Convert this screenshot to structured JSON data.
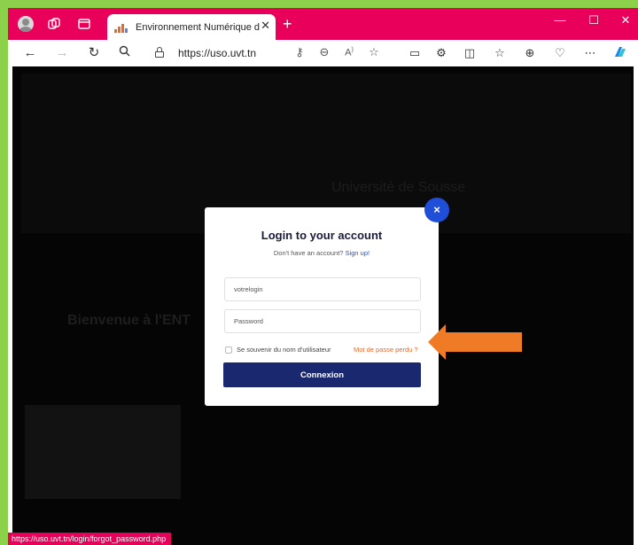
{
  "browser": {
    "tab_title": "Environnement Numérique de Tr",
    "url": "https://uso.uvt.tn",
    "status_url": "https://uso.uvt.tn/login/forgot_password.php",
    "accent_color": "#e8005a",
    "frame_color": "#8bd14a"
  },
  "page": {
    "hero_title": "Université de Sousse",
    "welcome_text": "Bienvenue à l'ENT"
  },
  "modal": {
    "title": "Login to your account",
    "subtitle_prefix": "Don't have an account?",
    "signup_link": "Sign up!",
    "login_placeholder": "votrelogin",
    "password_placeholder": "Password",
    "remember_label": "Se souvenir du nom d'utilisateur",
    "forgot_link": "Mot de passe perdu ?",
    "submit_label": "Connexion",
    "close_label": "×",
    "button_color": "#1a2870",
    "close_color": "#1f4fd9",
    "annotation_arrow_color": "#f07b26"
  },
  "icons": {
    "profile": "profile-icon",
    "workspaces": "workspaces-icon",
    "tab_actions": "tab-actions-icon",
    "back": "back-arrow-icon",
    "forward": "forward-arrow-icon",
    "refresh": "refresh-icon",
    "search": "search-icon",
    "lock": "lock-icon",
    "read_aloud": "read-aloud-icon",
    "favorite": "star-icon",
    "copilot": "copilot-icon"
  }
}
